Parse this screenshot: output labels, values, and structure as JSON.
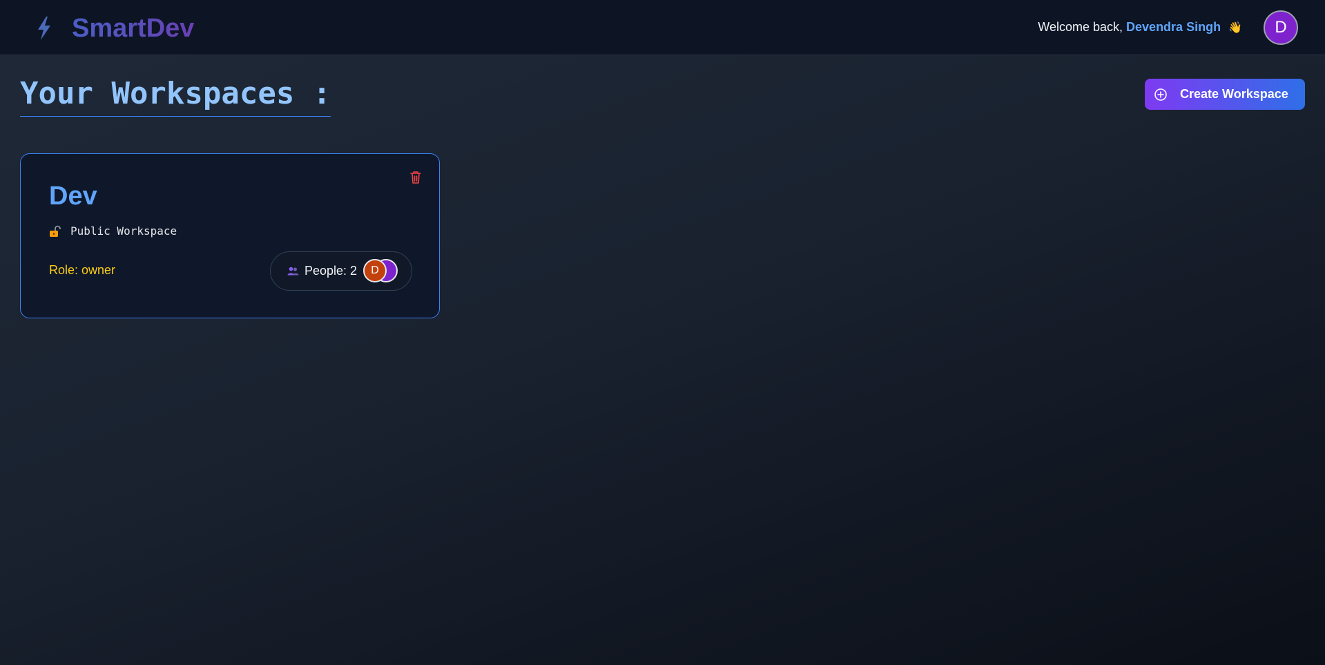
{
  "header": {
    "logo_text": "SmartDev",
    "logo_icon": "lightning-bolt-icon",
    "welcome_prefix": "Welcome back,",
    "user_name": "Devendra Singh",
    "wave_emoji": "👋",
    "avatar_initial": "D"
  },
  "main": {
    "title": "Your Workspaces :",
    "create_button_label": "Create Workspace",
    "create_button_icon": "plus-circle-icon"
  },
  "workspaces": [
    {
      "name": "Dev",
      "visibility_icon": "unlocked-padlock-icon",
      "visibility_label": "Public Workspace",
      "role_label": "Role: owner",
      "people_label": "People: 2",
      "member_initials": [
        "D",
        ""
      ],
      "delete_icon": "trash-icon"
    }
  ],
  "colors": {
    "accent_blue": "#60a5fa",
    "role_yellow": "#facc15",
    "delete_red": "#ef4444",
    "avatar_purple": "#7e22ce",
    "avatar_orange": "#c2410c",
    "button_gradient_start": "#7e3af2",
    "button_gradient_end": "#2f6fe8"
  }
}
